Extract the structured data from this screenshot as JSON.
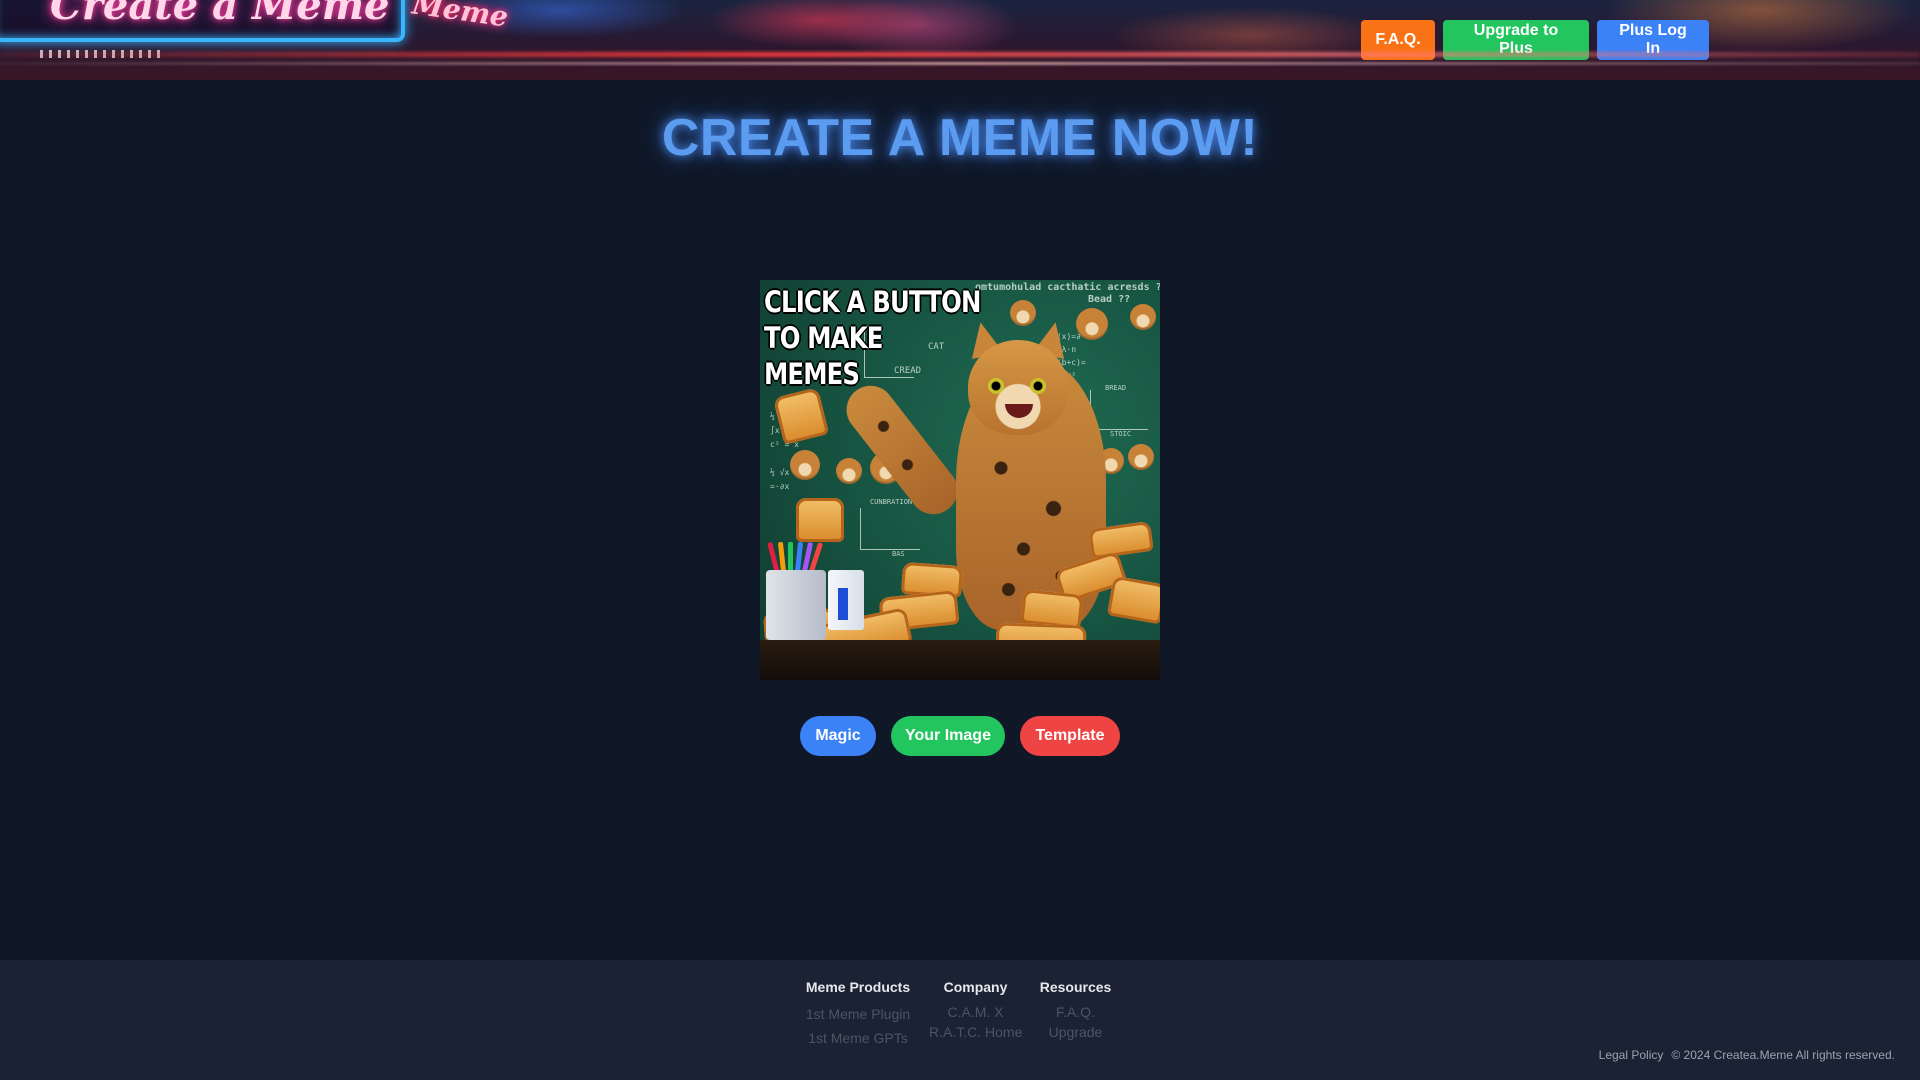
{
  "header": {
    "banner_sign_text": "Create a Meme",
    "banner_sign_text_2": "Meme",
    "nav": {
      "faq_label": "F.A.Q.",
      "upgrade_label": "Upgrade to Plus",
      "login_label": "Plus Log In"
    },
    "colors": {
      "faq": "#f97316",
      "upgrade": "#22c55e",
      "login": "#3b82f6"
    }
  },
  "hero": {
    "title": "CREATE A MEME NOW!",
    "title_color": "#5b9cf0"
  },
  "preview": {
    "caption": "CLICK A BUTTON\nTO MAKE\nMEMES",
    "chalk_top": "omtumohulad cacthatic acresds ?",
    "chalk_bead": "Bead ??",
    "chalk_cread": "CREAD",
    "chalk_cat": "CAT",
    "chalk_bread": "BREAD",
    "chalk_stoic": "STOIC",
    "chalk_cunbration": "CUNBRATION",
    "chalk_bas": "BAS"
  },
  "actions": {
    "magic_label": "Magic",
    "your_image_label": "Your Image",
    "template_label": "Template",
    "colors": {
      "magic": "#3b82f6",
      "your_image": "#22c55e",
      "template": "#ef4444"
    }
  },
  "footer": {
    "columns": [
      {
        "heading": "Meme Products",
        "links": [
          "1st Meme Plugin",
          "1st Meme GPTs"
        ]
      },
      {
        "heading": "Company",
        "links": [
          "C.A.M. X",
          "R.A.T.C. Home"
        ]
      },
      {
        "heading": "Resources",
        "links": [
          "F.A.Q.",
          "Upgrade"
        ]
      }
    ],
    "legal_link": "Legal Policy",
    "copyright": "© 2024 Createa.Meme All rights reserved."
  }
}
